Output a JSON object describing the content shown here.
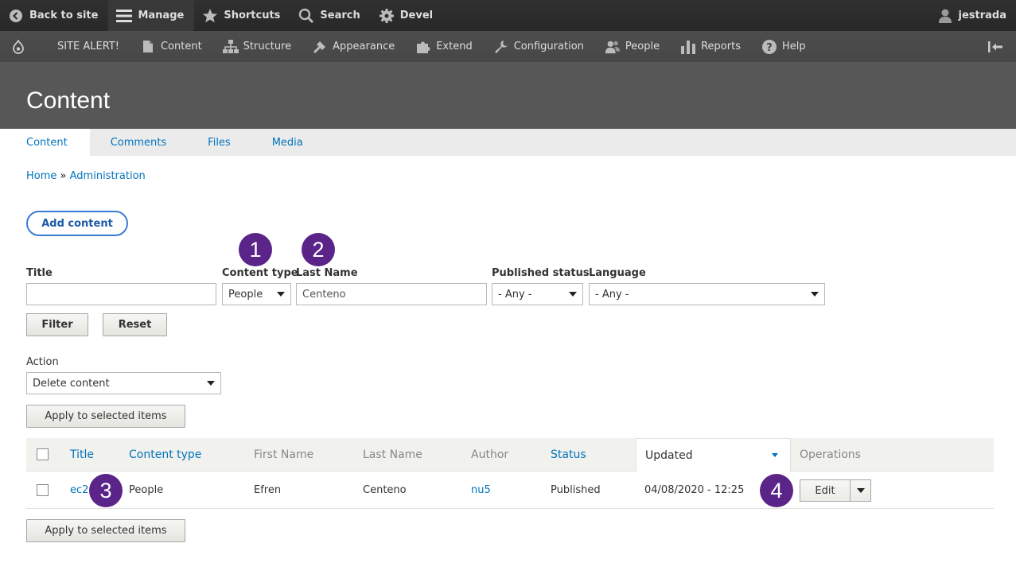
{
  "toolbar": {
    "back": "Back to site",
    "manage": "Manage",
    "shortcuts": "Shortcuts",
    "search": "Search",
    "devel": "Devel",
    "user": "jestrada"
  },
  "tray": {
    "alert": "SITE ALERT!",
    "items": [
      "Content",
      "Structure",
      "Appearance",
      "Extend",
      "Configuration",
      "People",
      "Reports",
      "Help"
    ]
  },
  "page": {
    "title": "Content"
  },
  "tabs": [
    "Content",
    "Comments",
    "Files",
    "Media"
  ],
  "breadcrumb": {
    "home": "Home",
    "sep": "»",
    "admin": "Administration"
  },
  "add_content": "Add content",
  "filters": {
    "title_label": "Title",
    "title_value": "",
    "content_type_label": "Content type",
    "content_type_value": "People",
    "last_name_label": "Last Name",
    "last_name_value": "Centeno",
    "published_label": "Published status",
    "published_value": "- Any -",
    "language_label": "Language",
    "language_value": "- Any -",
    "filter_btn": "Filter",
    "reset_btn": "Reset"
  },
  "action": {
    "label": "Action",
    "value": "Delete content",
    "apply": "Apply to selected items"
  },
  "table": {
    "headers": [
      "Title",
      "Content type",
      "First Name",
      "Last Name",
      "Author",
      "Status",
      "Updated",
      "Operations"
    ],
    "row": {
      "title": "ec2",
      "content_type": "People",
      "first_name": "Efren",
      "last_name": "Centeno",
      "author": "nu5",
      "status": "Published",
      "updated": "04/08/2020 - 12:25",
      "edit": "Edit"
    }
  },
  "markers": [
    "1",
    "2",
    "3",
    "4"
  ],
  "colors": {
    "marker": "#5b2489",
    "link": "#0074bd"
  }
}
